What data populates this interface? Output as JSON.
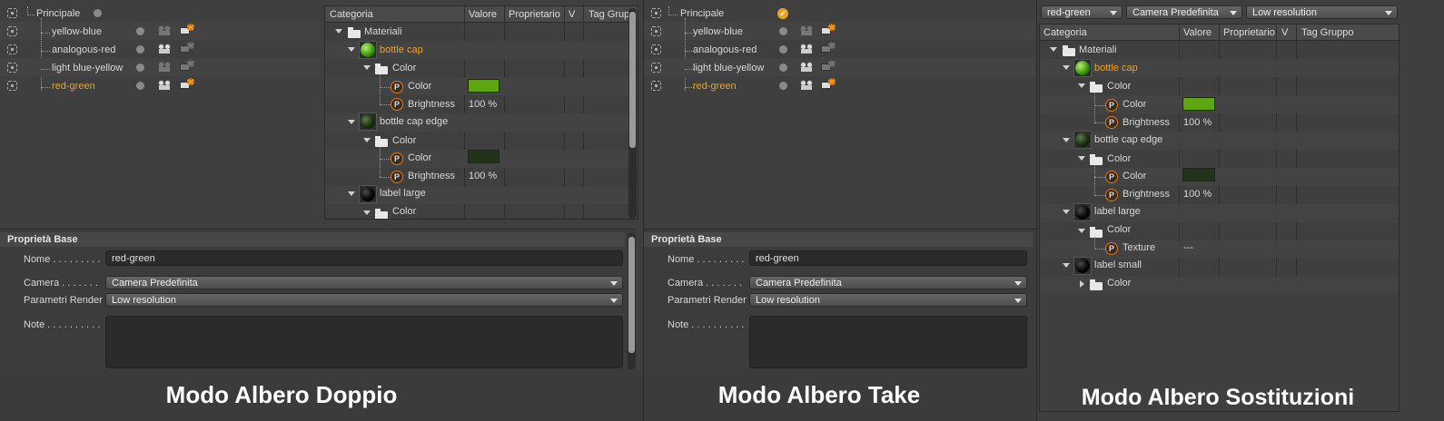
{
  "takes": {
    "root": "Principale",
    "items": [
      {
        "label": "yellow-blue"
      },
      {
        "label": "analogous-red"
      },
      {
        "label": "light blue-yellow"
      },
      {
        "label": "red-green"
      }
    ]
  },
  "columns": {
    "categoria": "Categoria",
    "valore": "Valore",
    "proprietario": "Proprietario",
    "v": "V",
    "tag_gruppo_short": "Tag Grup",
    "tag_gruppo": "Tag Gruppo"
  },
  "tree": {
    "materiali": "Materiali",
    "bottle_cap": "bottle cap",
    "color_group": "Color",
    "color": "Color",
    "brightness": "Brightness",
    "bottle_cap_edge": "bottle cap edge",
    "label_large": "label large",
    "texture": "Texture",
    "label_small": "label small",
    "brightness_value": "100 %",
    "texture_value": "---",
    "swatch_bottle_cap": "#5ea512",
    "swatch_bottle_cap_edge": "#22331a"
  },
  "props": {
    "title": "Proprietà Base",
    "nome_label": "Nome . . . . . . . . .",
    "nome_value": "red-green",
    "camera_label": "Camera . . . . . . .",
    "camera_value": "Camera Predefinita",
    "render_label": "Parametri Render",
    "render_value": "Low resolution",
    "note_label": "Note . . . . . . . . . ."
  },
  "toolbar3": {
    "take": "red-green",
    "camera": "Camera Predefinita",
    "render": "Low resolution"
  },
  "captions": {
    "doppio": "Modo Albero Doppio",
    "take": "Modo Albero Take",
    "sostituzioni": "Modo Albero Sostituzioni"
  },
  "colors": {
    "accent": "#f0a020",
    "background": "#3f3f3f"
  }
}
